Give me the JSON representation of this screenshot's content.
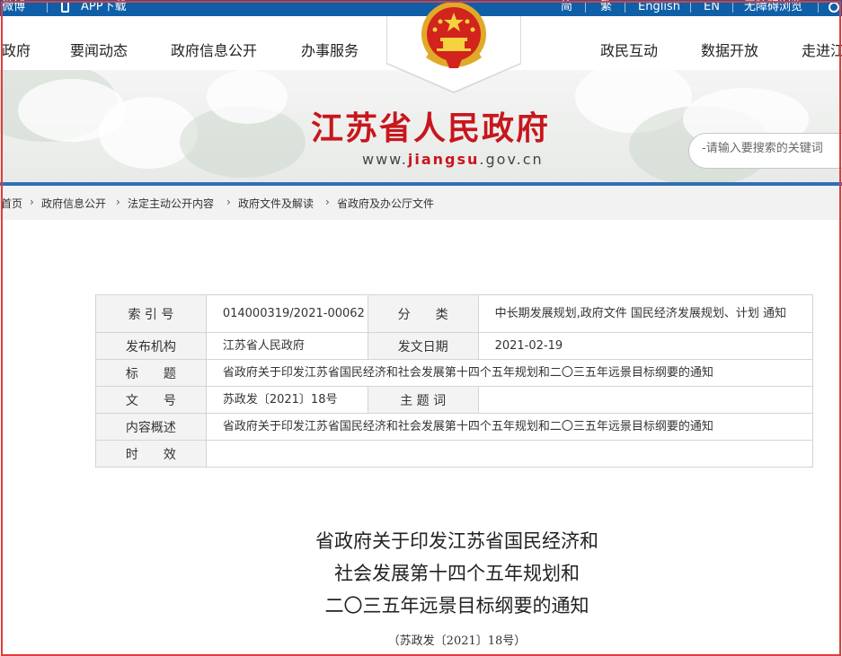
{
  "topbar": {
    "weibo": "微博",
    "app_download": "APP下载",
    "traditional": "简",
    "simplified": "繁",
    "english": "English",
    "en": "EN",
    "accessibility": "无障碍浏览"
  },
  "nav": {
    "items": [
      "政府",
      "要闻动态",
      "政府信息公开",
      "办事服务",
      "政民互动",
      "数据开放",
      "走进江"
    ]
  },
  "banner": {
    "title": "江苏省人民政府",
    "url_prefix": "www.",
    "url_brand": "jiangsu",
    "url_suffix": ".gov.cn",
    "search_placeholder": "-请输入要搜索的关键词"
  },
  "breadcrumb": [
    "首页",
    "政府信息公开",
    "法定主动公开内容",
    "政府文件及解读",
    "省政府及办公厅文件"
  ],
  "meta": {
    "index_label": "索 引 号",
    "index_value": "014000319/2021-00062",
    "category_label": "分　　类",
    "category_value": "中长期发展规划,政府文件 国民经济发展规划、计划 通知",
    "publisher_label": "发布机构",
    "publisher_value": "江苏省人民政府",
    "date_label": "发文日期",
    "date_value": "2021-02-19",
    "title_label": "标　　题",
    "title_value": "省政府关于印发江苏省国民经济和社会发展第十四个五年规划和二〇三五年远景目标纲要的通知",
    "docno_label": "文　　号",
    "docno_value": "苏政发〔2021〕18号",
    "keywords_label": "主 题 词",
    "keywords_value": "",
    "summary_label": "内容概述",
    "summary_value": "省政府关于印发江苏省国民经济和社会发展第十四个五年规划和二〇三五年远景目标纲要的通知",
    "validity_label": "时　　效",
    "validity_value": ""
  },
  "document": {
    "title_line1": "省政府关于印发江苏省国民经济和",
    "title_line2": "社会发展第十四个五年规划和",
    "title_line3": "二〇三五年远景目标纲要的通知",
    "doc_number": "（苏政发〔2021〕18号）"
  },
  "colors": {
    "brand_red": "#c8161d",
    "brand_blue": "#0f5fa8",
    "frame_red": "#e33b3b"
  }
}
